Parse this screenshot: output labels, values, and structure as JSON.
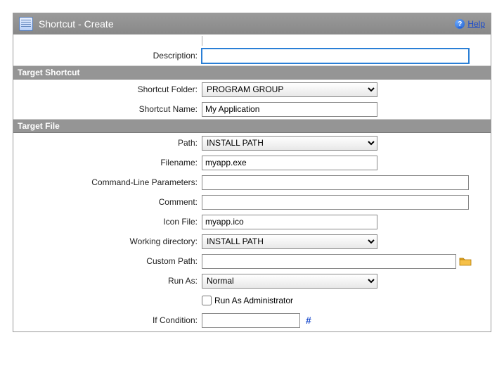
{
  "header": {
    "title": "Shortcut - Create",
    "help_label": "Help"
  },
  "labels": {
    "description": "Description:",
    "section_shortcut": "Target Shortcut",
    "shortcut_folder": "Shortcut Folder:",
    "shortcut_name": "Shortcut Name:",
    "section_file": "Target File",
    "path": "Path:",
    "filename": "Filename:",
    "cmd_params": "Command-Line Parameters:",
    "comment": "Comment:",
    "icon_file": "Icon File:",
    "working_dir": "Working directory:",
    "custom_path": "Custom Path:",
    "run_as": "Run As:",
    "run_as_admin": "Run As Administrator",
    "if_condition": "If Condition:"
  },
  "values": {
    "description": "",
    "shortcut_folder": "PROGRAM GROUP",
    "shortcut_name": "My Application",
    "path": "INSTALL PATH",
    "filename": "myapp.exe",
    "cmd_params": "",
    "comment": "",
    "icon_file": "myapp.ico",
    "working_dir": "INSTALL PATH",
    "custom_path": "",
    "run_as": "Normal",
    "run_as_admin": false,
    "if_condition": ""
  }
}
